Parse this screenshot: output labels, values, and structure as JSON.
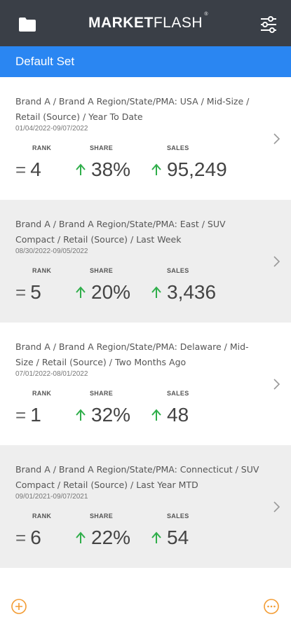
{
  "header": {
    "brand_bold": "MARKET",
    "brand_light": "FLASH",
    "brand_mark": "®",
    "left_icon": "folder-icon",
    "right_icon": "filter-sliders-icon"
  },
  "set": {
    "label": "Default Set"
  },
  "labels": {
    "rank": "RANK",
    "share": "SHARE",
    "sales": "SALES"
  },
  "cards": [
    {
      "title": "Brand A / Brand A Region/State/PMA: USA / Mid-Size / Retail (Source) / Year To Date",
      "date": "01/04/2022-09/07/2022",
      "rank": "4",
      "share": "38%",
      "sales": "95,249"
    },
    {
      "title": "Brand A / Brand A Region/State/PMA: East / SUV Compact / Retail (Source) / Last Week",
      "date": "08/30/2022-09/05/2022",
      "rank": "5",
      "share": "20%",
      "sales": "3,436"
    },
    {
      "title": "Brand A / Brand A Region/State/PMA: Delaware / Mid-Size / Retail (Source) / Two Months Ago",
      "date": "07/01/2022-08/01/2022",
      "rank": "1",
      "share": "32%",
      "sales": "48"
    },
    {
      "title": "Brand A / Brand A Region/State/PMA: Connecticut / SUV Compact / Retail (Source) / Last Year MTD",
      "date": "09/01/2021-09/07/2021",
      "rank": "6",
      "share": "22%",
      "sales": "54"
    }
  ],
  "colors": {
    "header_bg": "#3a3f47",
    "set_bar": "#2a86f2",
    "up_arrow": "#2fae4a",
    "accent_orange": "#f39c34"
  },
  "footer": {
    "left_icon": "add-circle-icon",
    "right_icon": "more-circle-icon"
  }
}
